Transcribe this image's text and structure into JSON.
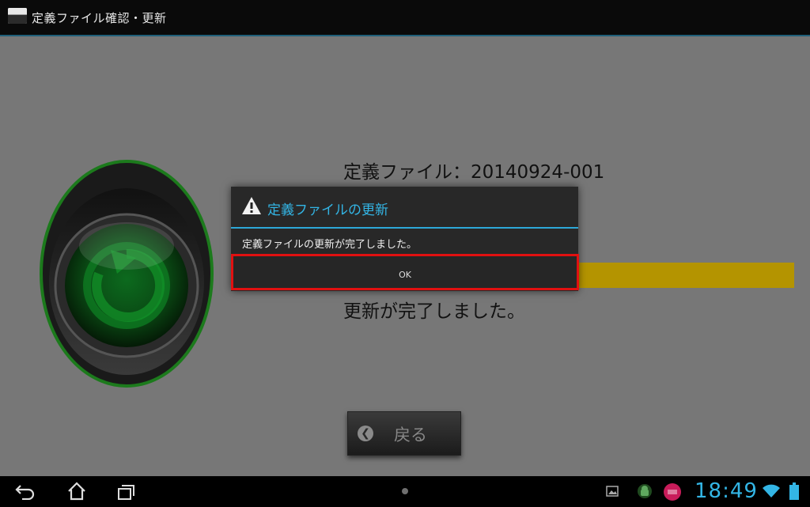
{
  "app": {
    "title": "定義ファイル確認・更新",
    "logo": "app-logo-icon"
  },
  "main": {
    "definition_file": "定義ファイル：20140924-001",
    "status": "更新が完了しました。",
    "progress": 1.0,
    "progress_color": "#b49400",
    "back_button_label": "戻る"
  },
  "dialog": {
    "title": "定義ファイルの更新",
    "message": "定義ファイルの更新が完了しました。",
    "ok_label": "OK",
    "accent_color": "#33b5e5",
    "highlight_color": "#e01010"
  },
  "navbar": {
    "clock": "18:49",
    "icons": [
      "back-icon",
      "home-icon",
      "recent-apps-icon",
      "gallery-icon",
      "android-icon",
      "app-notification-icon",
      "wifi-icon",
      "battery-icon"
    ]
  }
}
